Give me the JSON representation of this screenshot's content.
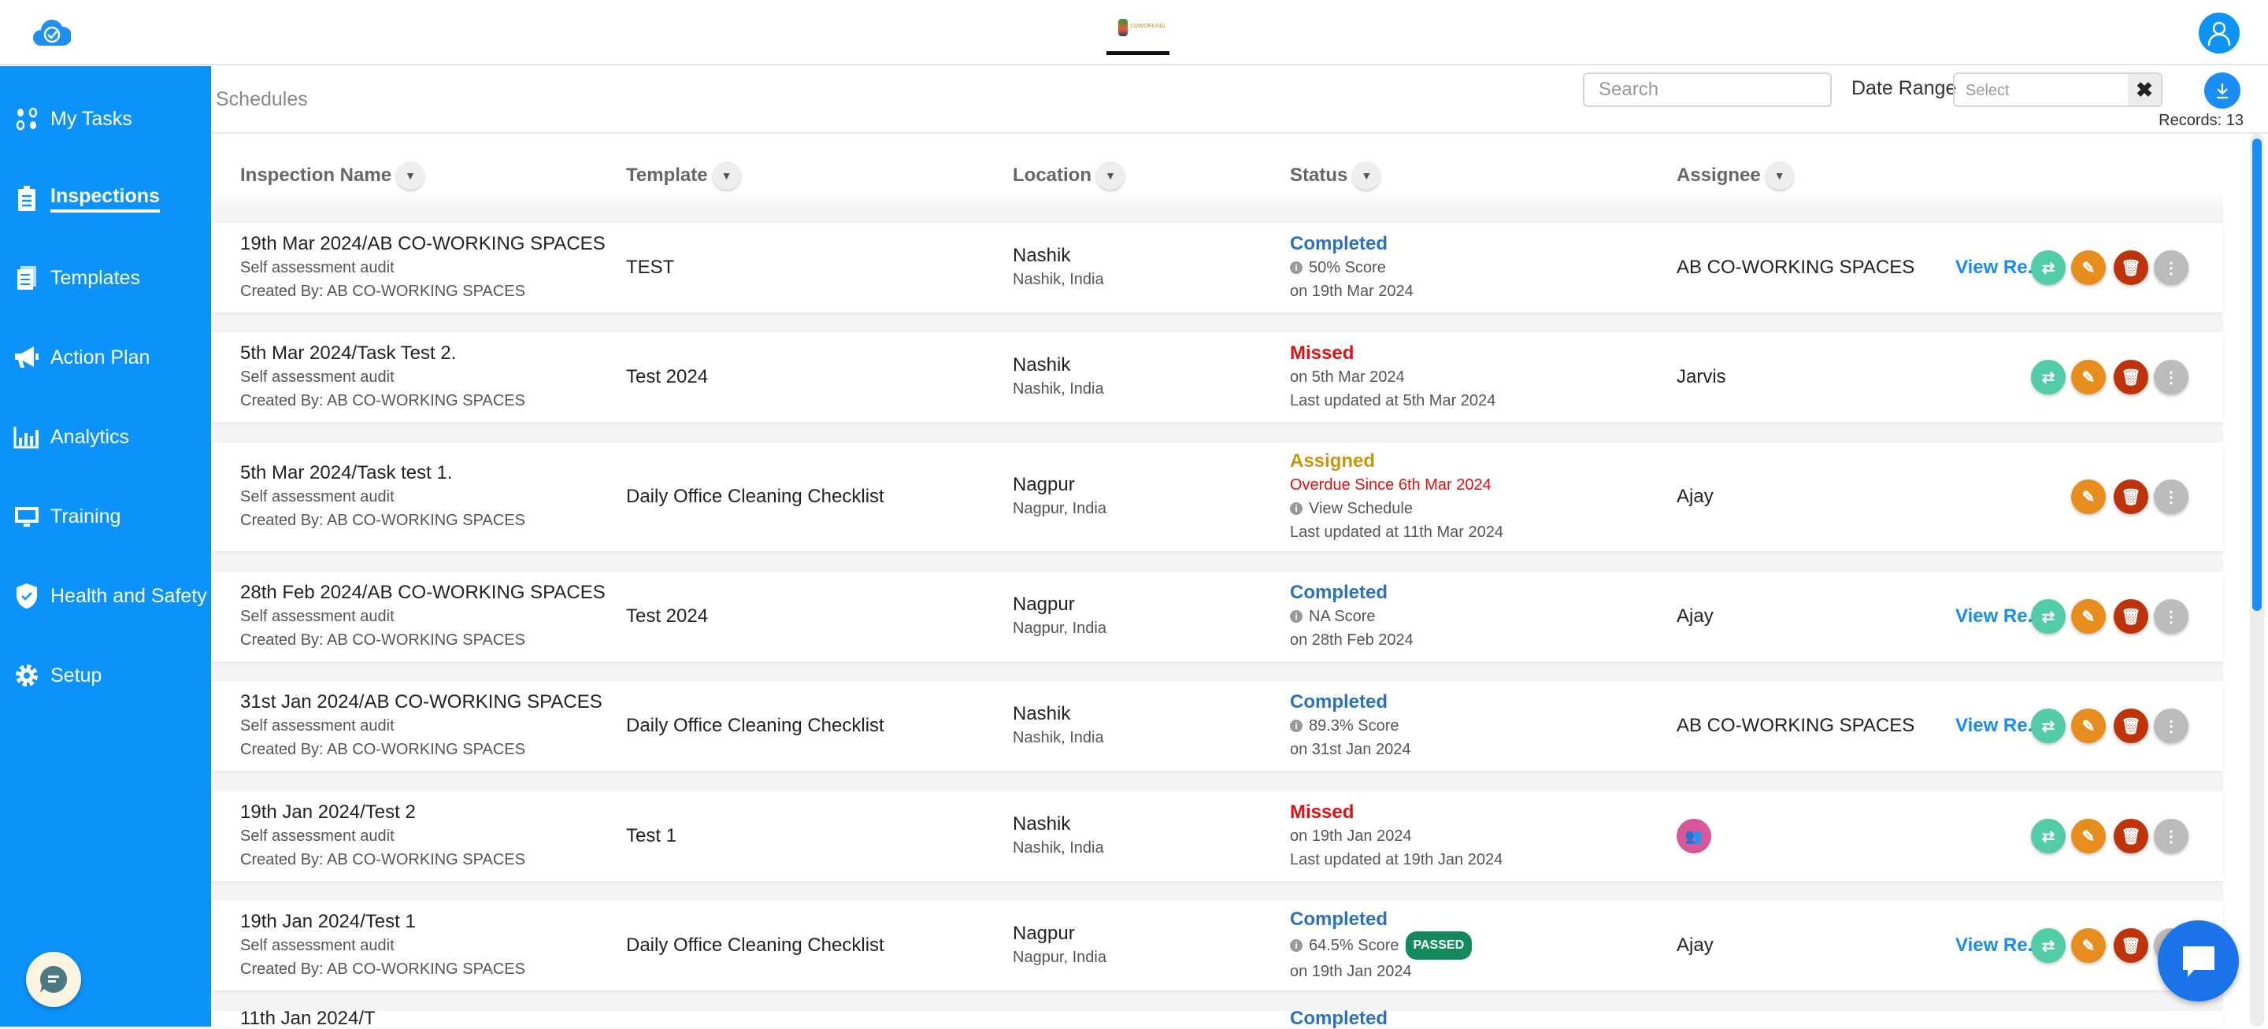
{
  "header": {
    "logo_icon": "cloud-check-icon",
    "user_icon": "user-icon"
  },
  "sidebar": {
    "items": [
      {
        "label": "My Tasks",
        "icon": "tasks-icon",
        "active": false
      },
      {
        "label": "Inspections",
        "icon": "clipboard-icon",
        "active": true
      },
      {
        "label": "Templates",
        "icon": "templates-icon",
        "active": false
      },
      {
        "label": "Action Plan",
        "icon": "megaphone-icon",
        "active": false
      },
      {
        "label": "Analytics",
        "icon": "analytics-icon",
        "active": false
      },
      {
        "label": "Training",
        "icon": "training-icon",
        "active": false
      },
      {
        "label": "Health and Safety",
        "icon": "shield-icon",
        "active": false
      },
      {
        "label": "Setup",
        "icon": "gear-icon",
        "active": false
      }
    ]
  },
  "toolbar": {
    "breadcrumb": "Schedules",
    "search_placeholder": "Search",
    "date_range_label": "Date Range",
    "date_range_placeholder": "Select",
    "clear": "✖",
    "records": "Records: 13"
  },
  "columns": [
    "Inspection Name",
    "Template",
    "Location",
    "Status",
    "Assignee"
  ],
  "colors": {
    "accent": "#0b93fb",
    "completed": "#2a72c0",
    "missed": "#e01010",
    "assigned": "#c8960c",
    "reassign": "#52cba9",
    "edit": "#e68d1e",
    "delete": "#be3309",
    "more": "#bbbbbb",
    "passed": "#138a5e"
  },
  "rows": [
    {
      "name": "19th Mar 2024/AB CO-WORKING SPACES",
      "type": "Self assessment audit",
      "created": "Created By: AB CO-WORKING SPACES",
      "template": "TEST",
      "city": "Nashik",
      "region": "Nashik, India",
      "status": "Completed",
      "status_kind": "completed",
      "lines": [
        {
          "text": "50%  Score",
          "info": true
        },
        {
          "text": "on 19th Mar 2024"
        }
      ],
      "assignee": "AB CO-WORKING SPACES",
      "view": "View Re...",
      "actions": [
        "reassign",
        "edit",
        "delete",
        "more"
      ]
    },
    {
      "name": "5th Mar 2024/Task Test 2.",
      "type": "Self assessment audit",
      "created": "Created By: AB CO-WORKING SPACES",
      "template": "Test 2024",
      "city": "Nashik",
      "region": "Nashik, India",
      "status": "Missed",
      "status_kind": "missed",
      "lines": [
        {
          "text": "on 5th Mar 2024"
        },
        {
          "text": "Last updated at 5th Mar 2024"
        }
      ],
      "assignee": "Jarvis",
      "actions": [
        "reassign",
        "edit",
        "delete",
        "more"
      ]
    },
    {
      "name": "5th Mar 2024/Task test 1.",
      "type": "Self assessment audit",
      "created": "Created By: AB CO-WORKING SPACES",
      "template": "Daily Office Cleaning Checklist",
      "city": "Nagpur",
      "region": "Nagpur, India",
      "status": "Assigned",
      "status_kind": "assigned",
      "lines": [
        {
          "text": "Overdue Since 6th Mar 2024",
          "red": true
        },
        {
          "text": "View Schedule",
          "info": true
        },
        {
          "text": "Last updated at 11th Mar 2024"
        }
      ],
      "assignee": "Ajay",
      "actions": [
        "edit",
        "delete",
        "more"
      ]
    },
    {
      "name": "28th Feb 2024/AB CO-WORKING SPACES",
      "type": "Self assessment audit",
      "created": "Created By: AB CO-WORKING SPACES",
      "template": "Test 2024",
      "city": "Nagpur",
      "region": "Nagpur, India",
      "status": "Completed",
      "status_kind": "completed",
      "lines": [
        {
          "text": "NA  Score",
          "info": true
        },
        {
          "text": "on 28th Feb 2024"
        }
      ],
      "assignee": "Ajay",
      "view": "View Re...",
      "actions": [
        "reassign",
        "edit",
        "delete",
        "more"
      ]
    },
    {
      "name": "31st Jan 2024/AB CO-WORKING SPACES",
      "type": "Self assessment audit",
      "created": "Created By: AB CO-WORKING SPACES",
      "template": "Daily Office Cleaning Checklist",
      "city": "Nashik",
      "region": "Nashik, India",
      "status": "Completed",
      "status_kind": "completed",
      "lines": [
        {
          "text": "89.3%  Score",
          "info": true
        },
        {
          "text": "on 31st Jan 2024"
        }
      ],
      "assignee": "AB CO-WORKING SPACES",
      "view": "View Re...",
      "actions": [
        "reassign",
        "edit",
        "delete",
        "more"
      ]
    },
    {
      "name": "19th Jan 2024/Test 2",
      "type": "Self assessment audit",
      "created": "Created By: AB CO-WORKING SPACES",
      "template": "Test 1",
      "city": "Nashik",
      "region": "Nashik, India",
      "status": "Missed",
      "status_kind": "missed",
      "lines": [
        {
          "text": "on 19th Jan 2024"
        },
        {
          "text": "Last updated at 19th Jan 2024"
        }
      ],
      "assignee_icon": "group-icon",
      "actions": [
        "reassign",
        "edit",
        "delete",
        "more"
      ]
    },
    {
      "name": "19th Jan 2024/Test 1",
      "type": "Self assessment audit",
      "created": "Created By: AB CO-WORKING SPACES",
      "template": "Daily Office Cleaning Checklist",
      "city": "Nagpur",
      "region": "Nagpur, India",
      "status": "Completed",
      "status_kind": "completed",
      "lines": [
        {
          "text": "64.5% Score",
          "info": true,
          "badge": "PASSED"
        },
        {
          "text": "on 19th Jan 2024"
        }
      ],
      "assignee": "Ajay",
      "view": "View Re...",
      "actions": [
        "reassign",
        "edit",
        "delete",
        "more"
      ]
    },
    {
      "name": "11th Jan 2024/T",
      "status": "Completed",
      "status_kind": "completed",
      "clipped": true
    }
  ]
}
